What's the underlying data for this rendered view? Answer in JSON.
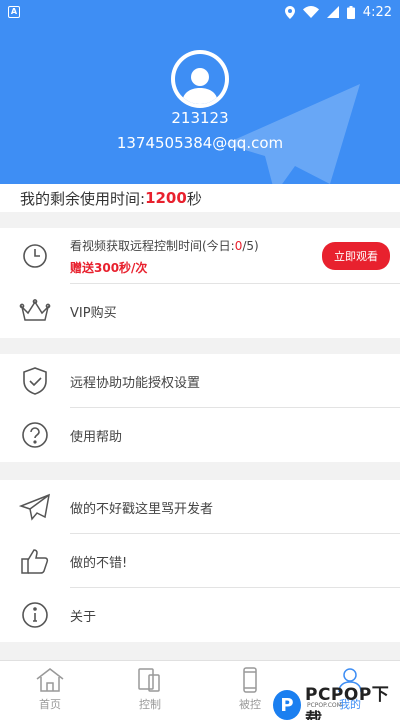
{
  "status_bar": {
    "time": "4:22",
    "colors": {
      "bg": "#3e8ef4"
    }
  },
  "profile": {
    "username": "213123",
    "email": "1374505384@qq.com"
  },
  "remaining": {
    "prefix": "我的剩余使用时间:",
    "value": "1200",
    "unit": "秒"
  },
  "video_item": {
    "title_prefix": "看视频获取远程控制时间(今日:",
    "count": "0",
    "title_suffix": "/5)",
    "reward": "赠送300秒/次",
    "button_label": "立即观看",
    "icon": "clock-icon"
  },
  "menu": {
    "vip": {
      "label": "VIP购买",
      "icon": "crown-icon"
    },
    "auth": {
      "label": "远程协助功能授权设置",
      "icon": "shield-check-icon"
    },
    "help": {
      "label": "使用帮助",
      "icon": "question-icon"
    },
    "complain": {
      "label": "做的不好戳这里骂开发者",
      "icon": "paper-plane-icon"
    },
    "like": {
      "label": "做的不错!",
      "icon": "thumbs-up-icon"
    },
    "about": {
      "label": "关于",
      "icon": "info-icon"
    }
  },
  "tabs": [
    {
      "label": "首页",
      "icon": "home-icon"
    },
    {
      "label": "控制",
      "icon": "devices-icon"
    },
    {
      "label": "被控",
      "icon": "phone-icon"
    },
    {
      "label": "我的",
      "icon": "user-icon",
      "active": true
    }
  ],
  "watermark": {
    "text": "PCPOP下载",
    "sub": "PCPOP.COM"
  },
  "colors": {
    "accent": "#3e8ef4",
    "alert": "#e8212e"
  }
}
